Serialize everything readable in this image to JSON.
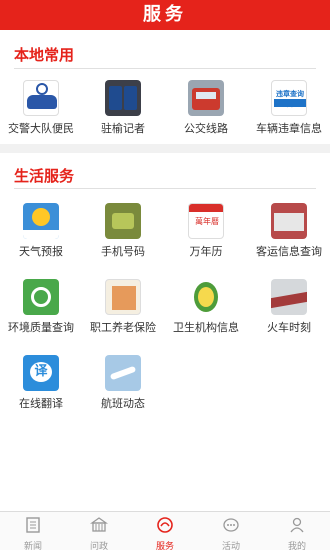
{
  "header": {
    "title": "服务"
  },
  "local": {
    "title": "本地常用",
    "items": [
      {
        "label": "交警大队便民",
        "icon": "police-car-icon"
      },
      {
        "label": "驻榆记者",
        "icon": "reporter-card-icon"
      },
      {
        "label": "公交线路",
        "icon": "bus-icon"
      },
      {
        "label": "车辆违章信息",
        "icon": "traffic-violation-icon",
        "icon_text": "违章查询网"
      }
    ]
  },
  "life": {
    "title": "生活服务",
    "items": [
      {
        "label": "天气预报",
        "icon": "weather-icon"
      },
      {
        "label": "手机号码",
        "icon": "phone-number-icon"
      },
      {
        "label": "万年历",
        "icon": "calendar-icon",
        "icon_text": "萬年曆"
      },
      {
        "label": "客运信息查询",
        "icon": "coach-bus-icon"
      },
      {
        "label": "环境质量查询",
        "icon": "environment-icon"
      },
      {
        "label": "职工养老保险",
        "icon": "pension-icon"
      },
      {
        "label": "卫生机构信息",
        "icon": "health-icon"
      },
      {
        "label": "火车时刻",
        "icon": "train-icon"
      },
      {
        "label": "在线翻译",
        "icon": "translate-icon",
        "icon_text": "译"
      },
      {
        "label": "航班动态",
        "icon": "flight-icon"
      }
    ]
  },
  "tabbar": {
    "tabs": [
      {
        "label": "新闻",
        "icon": "news-icon",
        "active": false
      },
      {
        "label": "问政",
        "icon": "gov-icon",
        "active": false
      },
      {
        "label": "服务",
        "icon": "service-icon",
        "active": true
      },
      {
        "label": "活动",
        "icon": "activity-icon",
        "active": false
      },
      {
        "label": "我的",
        "icon": "profile-icon",
        "active": false
      }
    ]
  },
  "colors": {
    "brand": "#e5231b",
    "text": "#333333",
    "tab_inactive": "#999999"
  }
}
